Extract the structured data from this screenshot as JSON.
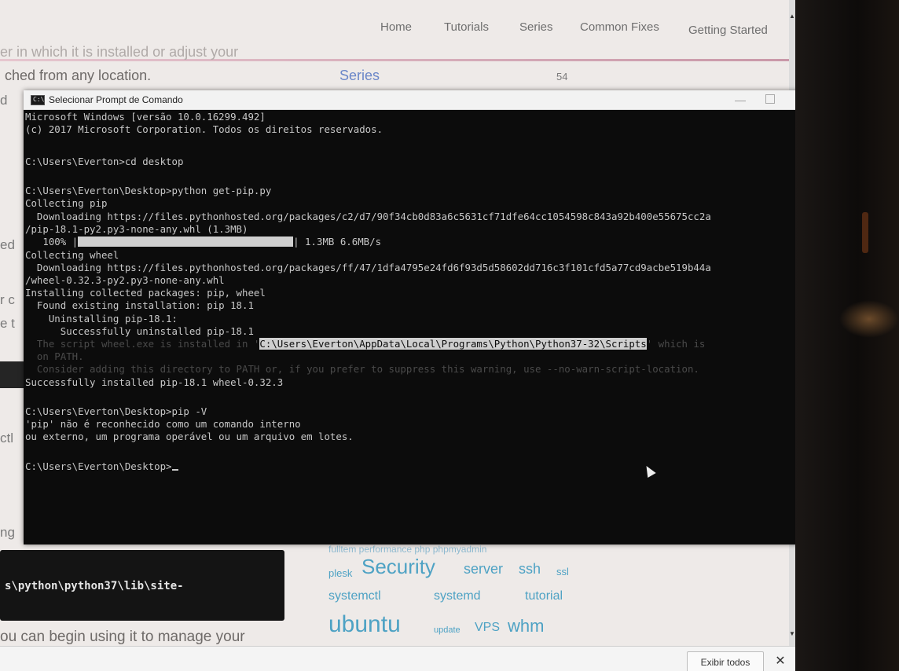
{
  "site_nav": {
    "items": [
      "Home",
      "Tutorials",
      "Series",
      "Common Fixes",
      "Getting Started"
    ]
  },
  "page": {
    "line1": "er in which it is installed or adjust your",
    "line2": "ched from any location.",
    "series_label": "Series",
    "series_count": "54",
    "edge_fragments": [
      "d",
      "ed",
      "r c",
      "e t",
      "ctl",
      "ng"
    ],
    "code_box_text": "s\\python\\python37\\lib\\site-",
    "bottom_text": "ou can begin using it to manage your",
    "tag_cloud_partial": "fulltem performance php phpmyadmin",
    "tags": [
      "plesk",
      "Security",
      "server",
      "ssh",
      "ssl",
      "systemctl",
      "systemd",
      "tutorial",
      "ubuntu",
      "update",
      "VPS",
      "whm"
    ]
  },
  "cmd": {
    "title": "Selecionar Prompt de Comando",
    "icon_label": "C:\\",
    "lines": [
      "Microsoft Windows [versão 10.0.16299.492]",
      "(c) 2017 Microsoft Corporation. Todos os direitos reservados.",
      "",
      "C:\\Users\\Everton>cd desktop",
      "",
      "C:\\Users\\Everton\\Desktop>python get-pip.py",
      "Collecting pip",
      "  Downloading https://files.pythonhosted.org/packages/c2/d7/90f34cb0d83a6c5631cf71dfe64cc1054598c843a92b400e55675cc2a",
      "/pip-18.1-py2.py3-none-any.whl (1.3MB)",
      "",
      "Collecting wheel",
      "  Downloading https://files.pythonhosted.org/packages/ff/47/1dfa4795e24fd6f93d5d58602dd716c3f101cfd5a77cd9acbe519b44a",
      "/wheel-0.32.3-py2.py3-none-any.whl",
      "Installing collected packages: pip, wheel",
      "  Found existing installation: pip 18.1",
      "    Uninstalling pip-18.1:",
      "      Successfully uninstalled pip-18.1",
      "",
      "  on PATH.",
      "  Consider adding this directory to PATH or, if you prefer to suppress this warning, use --no-warn-script-location.",
      "Successfully installed pip-18.1 wheel-0.32.3",
      "",
      "C:\\Users\\Everton\\Desktop>pip -V",
      "'pip' não é reconhecido como um comando interno",
      "ou externo, um programa operável ou um arquivo em lotes.",
      "",
      "C:\\Users\\Everton\\Desktop>"
    ],
    "progress": {
      "percent_label": "   100% |",
      "value": 1.0,
      "suffix": "| 1.3MB 6.6MB/s"
    },
    "warning": {
      "prefix": "  The script wheel.exe is installed in '",
      "path": "C:\\Users\\Everton\\AppData\\Local\\Programs\\Python\\Python37-32\\Scripts",
      "suffix": "' which is"
    }
  },
  "download_bar": {
    "show_all": "Exibir todos",
    "close": "✕"
  },
  "colors": {
    "terminal_bg": "#0c0c0c",
    "terminal_fg": "#c8c8c8",
    "selection": "#cfcfcf",
    "link_blue": "#6a86c8",
    "tag_blue": "#4ea2c4"
  }
}
